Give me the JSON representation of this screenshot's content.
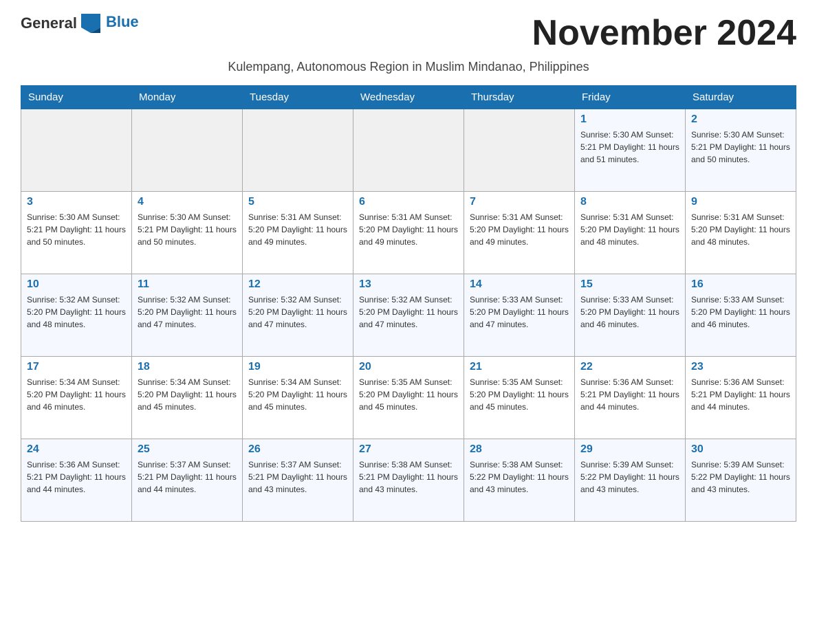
{
  "header": {
    "logo_general": "General",
    "logo_blue": "Blue",
    "month_title": "November 2024",
    "subtitle": "Kulempang, Autonomous Region in Muslim Mindanao, Philippines"
  },
  "days_of_week": [
    "Sunday",
    "Monday",
    "Tuesday",
    "Wednesday",
    "Thursday",
    "Friday",
    "Saturday"
  ],
  "weeks": [
    [
      {
        "day": "",
        "info": ""
      },
      {
        "day": "",
        "info": ""
      },
      {
        "day": "",
        "info": ""
      },
      {
        "day": "",
        "info": ""
      },
      {
        "day": "",
        "info": ""
      },
      {
        "day": "1",
        "info": "Sunrise: 5:30 AM\nSunset: 5:21 PM\nDaylight: 11 hours\nand 51 minutes."
      },
      {
        "day": "2",
        "info": "Sunrise: 5:30 AM\nSunset: 5:21 PM\nDaylight: 11 hours\nand 50 minutes."
      }
    ],
    [
      {
        "day": "3",
        "info": "Sunrise: 5:30 AM\nSunset: 5:21 PM\nDaylight: 11 hours\nand 50 minutes."
      },
      {
        "day": "4",
        "info": "Sunrise: 5:30 AM\nSunset: 5:21 PM\nDaylight: 11 hours\nand 50 minutes."
      },
      {
        "day": "5",
        "info": "Sunrise: 5:31 AM\nSunset: 5:20 PM\nDaylight: 11 hours\nand 49 minutes."
      },
      {
        "day": "6",
        "info": "Sunrise: 5:31 AM\nSunset: 5:20 PM\nDaylight: 11 hours\nand 49 minutes."
      },
      {
        "day": "7",
        "info": "Sunrise: 5:31 AM\nSunset: 5:20 PM\nDaylight: 11 hours\nand 49 minutes."
      },
      {
        "day": "8",
        "info": "Sunrise: 5:31 AM\nSunset: 5:20 PM\nDaylight: 11 hours\nand 48 minutes."
      },
      {
        "day": "9",
        "info": "Sunrise: 5:31 AM\nSunset: 5:20 PM\nDaylight: 11 hours\nand 48 minutes."
      }
    ],
    [
      {
        "day": "10",
        "info": "Sunrise: 5:32 AM\nSunset: 5:20 PM\nDaylight: 11 hours\nand 48 minutes."
      },
      {
        "day": "11",
        "info": "Sunrise: 5:32 AM\nSunset: 5:20 PM\nDaylight: 11 hours\nand 47 minutes."
      },
      {
        "day": "12",
        "info": "Sunrise: 5:32 AM\nSunset: 5:20 PM\nDaylight: 11 hours\nand 47 minutes."
      },
      {
        "day": "13",
        "info": "Sunrise: 5:32 AM\nSunset: 5:20 PM\nDaylight: 11 hours\nand 47 minutes."
      },
      {
        "day": "14",
        "info": "Sunrise: 5:33 AM\nSunset: 5:20 PM\nDaylight: 11 hours\nand 47 minutes."
      },
      {
        "day": "15",
        "info": "Sunrise: 5:33 AM\nSunset: 5:20 PM\nDaylight: 11 hours\nand 46 minutes."
      },
      {
        "day": "16",
        "info": "Sunrise: 5:33 AM\nSunset: 5:20 PM\nDaylight: 11 hours\nand 46 minutes."
      }
    ],
    [
      {
        "day": "17",
        "info": "Sunrise: 5:34 AM\nSunset: 5:20 PM\nDaylight: 11 hours\nand 46 minutes."
      },
      {
        "day": "18",
        "info": "Sunrise: 5:34 AM\nSunset: 5:20 PM\nDaylight: 11 hours\nand 45 minutes."
      },
      {
        "day": "19",
        "info": "Sunrise: 5:34 AM\nSunset: 5:20 PM\nDaylight: 11 hours\nand 45 minutes."
      },
      {
        "day": "20",
        "info": "Sunrise: 5:35 AM\nSunset: 5:20 PM\nDaylight: 11 hours\nand 45 minutes."
      },
      {
        "day": "21",
        "info": "Sunrise: 5:35 AM\nSunset: 5:20 PM\nDaylight: 11 hours\nand 45 minutes."
      },
      {
        "day": "22",
        "info": "Sunrise: 5:36 AM\nSunset: 5:21 PM\nDaylight: 11 hours\nand 44 minutes."
      },
      {
        "day": "23",
        "info": "Sunrise: 5:36 AM\nSunset: 5:21 PM\nDaylight: 11 hours\nand 44 minutes."
      }
    ],
    [
      {
        "day": "24",
        "info": "Sunrise: 5:36 AM\nSunset: 5:21 PM\nDaylight: 11 hours\nand 44 minutes."
      },
      {
        "day": "25",
        "info": "Sunrise: 5:37 AM\nSunset: 5:21 PM\nDaylight: 11 hours\nand 44 minutes."
      },
      {
        "day": "26",
        "info": "Sunrise: 5:37 AM\nSunset: 5:21 PM\nDaylight: 11 hours\nand 43 minutes."
      },
      {
        "day": "27",
        "info": "Sunrise: 5:38 AM\nSunset: 5:21 PM\nDaylight: 11 hours\nand 43 minutes."
      },
      {
        "day": "28",
        "info": "Sunrise: 5:38 AM\nSunset: 5:22 PM\nDaylight: 11 hours\nand 43 minutes."
      },
      {
        "day": "29",
        "info": "Sunrise: 5:39 AM\nSunset: 5:22 PM\nDaylight: 11 hours\nand 43 minutes."
      },
      {
        "day": "30",
        "info": "Sunrise: 5:39 AM\nSunset: 5:22 PM\nDaylight: 11 hours\nand 43 minutes."
      }
    ]
  ]
}
